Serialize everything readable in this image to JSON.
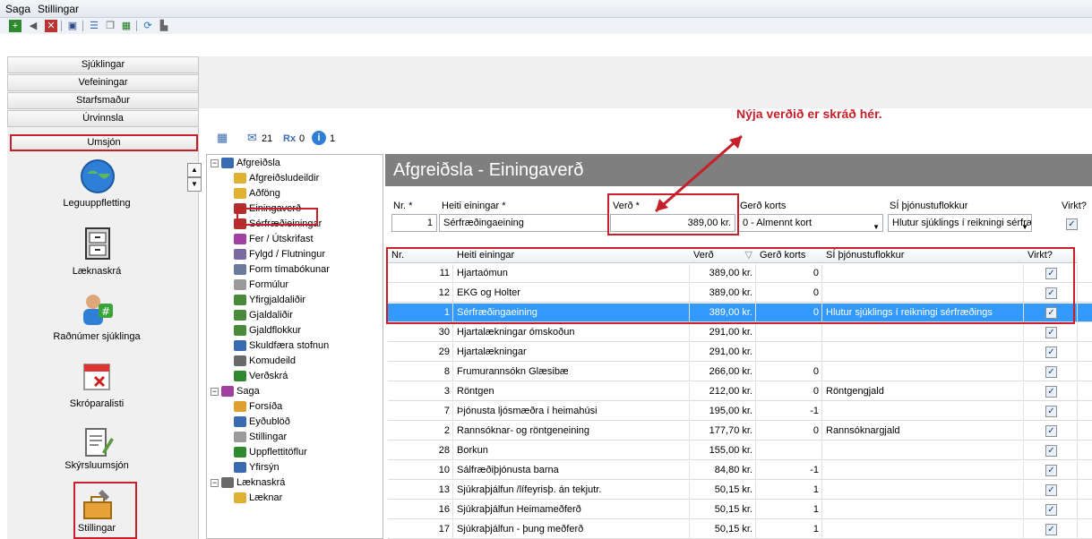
{
  "menu": [
    "Saga",
    "Stillingar"
  ],
  "nav_buttons": [
    "Sjúklingar",
    "Vefeiningar",
    "Starfsmaður",
    "Úrvinnsla",
    "Umsjón"
  ],
  "nav_modules": [
    "Leguuppfletting",
    "Læknaskrá",
    "Raðnúmer sjúklinga",
    "Skróparalisti",
    "Skýrsluumsjón",
    "Stillingar"
  ],
  "status": {
    "messages": "21",
    "rx": "0",
    "info": "1"
  },
  "annotation": "Nýja verðið er skráð hér.",
  "tree": [
    {
      "label": "Afgreiðsla",
      "level": 0,
      "expander": "-"
    },
    {
      "label": "Afgreiðsludeildir",
      "level": 1
    },
    {
      "label": "Aðföng",
      "level": 1
    },
    {
      "label": "Einingaverð",
      "level": 1
    },
    {
      "label": "Sérfræðieiningar",
      "level": 1
    },
    {
      "label": "Fer / Útskrifast",
      "level": 1
    },
    {
      "label": "Fylgd / Flutningur",
      "level": 1
    },
    {
      "label": "Form tímabókunar",
      "level": 1
    },
    {
      "label": "Formúlur",
      "level": 1
    },
    {
      "label": "Yfirgjaldaliðir",
      "level": 1
    },
    {
      "label": "Gjaldaliðir",
      "level": 1
    },
    {
      "label": "Gjaldflokkur",
      "level": 1
    },
    {
      "label": "Skuldfæra stofnun",
      "level": 1
    },
    {
      "label": "Komudeild",
      "level": 1
    },
    {
      "label": "Verðskrá",
      "level": 1
    },
    {
      "label": "Saga",
      "level": 0,
      "expander": "-"
    },
    {
      "label": "Forsíða",
      "level": 1
    },
    {
      "label": "Eyðublöð",
      "level": 1
    },
    {
      "label": "Stillingar",
      "level": 1
    },
    {
      "label": "Uppflettitöflur",
      "level": 1
    },
    {
      "label": "Yfirsýn",
      "level": 1
    },
    {
      "label": "Læknaskrá",
      "level": 0,
      "expander": "-"
    },
    {
      "label": "Læknar",
      "level": 1
    }
  ],
  "panel": {
    "title": "Afgreiðsla - Einingaverð",
    "form": {
      "nr_label": "Nr. *",
      "nr_value": "1",
      "heiti_label": "Heiti einingar *",
      "heiti_value": "Sérfræðingaeining",
      "verd_label": "Verð *",
      "verd_value": "389,00 kr.",
      "gerd_label": "Gerð korts",
      "gerd_value": "0 - Almennt kort",
      "si_label": "SÍ þjónustuflokkur",
      "si_value": "Hlutur sjúklings í reikningi sérfræ",
      "virkt_label": "Virkt?"
    },
    "columns": [
      "Nr.",
      "Heiti einingar",
      "Verð",
      "Gerð korts",
      "SÍ þjónustuflokkur",
      "Virkt?"
    ],
    "rows": [
      [
        "11",
        "Hjartaómun",
        "389,00 kr.",
        "0",
        "",
        "✓"
      ],
      [
        "12",
        "EKG og Holter",
        "389,00 kr.",
        "0",
        "",
        "✓"
      ],
      [
        "1",
        "Sérfræðingaeining",
        "389,00 kr.",
        "0",
        "Hlutur sjúklings í reikningi sérfræðings",
        "✓"
      ],
      [
        "30",
        "Hjartalækningar ómskoðun",
        "291,00 kr.",
        "",
        "",
        "✓"
      ],
      [
        "29",
        "Hjartalækningar",
        "291,00 kr.",
        "",
        "",
        "✓"
      ],
      [
        "8",
        "Frumurannsókn Glæsibæ",
        "266,00 kr.",
        "0",
        "",
        "✓"
      ],
      [
        "3",
        "Röntgen",
        "212,00 kr.",
        "0",
        "Röntgengjald",
        "✓"
      ],
      [
        "7",
        "Þjónusta ljósmæðra í heimahúsi",
        "195,00 kr.",
        "-1",
        "",
        "✓"
      ],
      [
        "2",
        "Rannsóknar- og röntgeneining",
        "177,70 kr.",
        "0",
        "Rannsóknargjald",
        "✓"
      ],
      [
        "28",
        "Borkun",
        "155,00 kr.",
        "",
        "",
        "✓"
      ],
      [
        "10",
        "Sálfræðiþjónusta barna",
        "84,80 kr.",
        "-1",
        "",
        "✓"
      ],
      [
        "13",
        "Sjúkraþjálfun /lífeyrisþ. án tekjutr.",
        "50,15 kr.",
        "1",
        "",
        "✓"
      ],
      [
        "16",
        "Sjúkraþjálfun Heimameðferð",
        "50,15 kr.",
        "1",
        "",
        "✓"
      ],
      [
        "17",
        "Sjúkraþjálfun - þung meðferð",
        "50,15 kr.",
        "1",
        "",
        "✓"
      ]
    ],
    "selected_row": 2
  }
}
